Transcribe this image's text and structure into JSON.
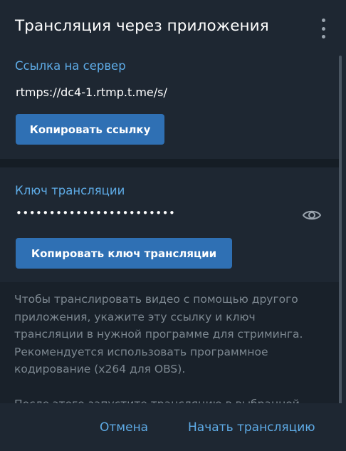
{
  "dialog": {
    "title": "Трансляция через приложения",
    "menu_icon": "more-vertical-icon"
  },
  "server": {
    "label": "Ссылка на сервер",
    "url": "rtmps://dc4-1.rtmp.t.me/s/",
    "copy_button": "Копировать ссылку"
  },
  "stream_key": {
    "label": "Ключ трансляции",
    "masked_value": "••••••••••••••••••••••••",
    "visibility_icon": "eye-icon",
    "copy_button": "Копировать ключ трансляции"
  },
  "info": {
    "paragraph1": "Чтобы транслировать видео с помощью другого приложения, укажите эту ссылку и ключ трансляции в нужной программе для стриминга. Рекомендуется использовать программное кодирование (x264 для OBS).",
    "paragraph2": "После этого запустите трансляцию в выбранной"
  },
  "footer": {
    "cancel": "Отмена",
    "start": "Начать трансляцию"
  },
  "colors": {
    "background": "#1e2732",
    "accent": "#5eabe6",
    "button": "#2f70b4",
    "muted_text": "#7d8891"
  }
}
